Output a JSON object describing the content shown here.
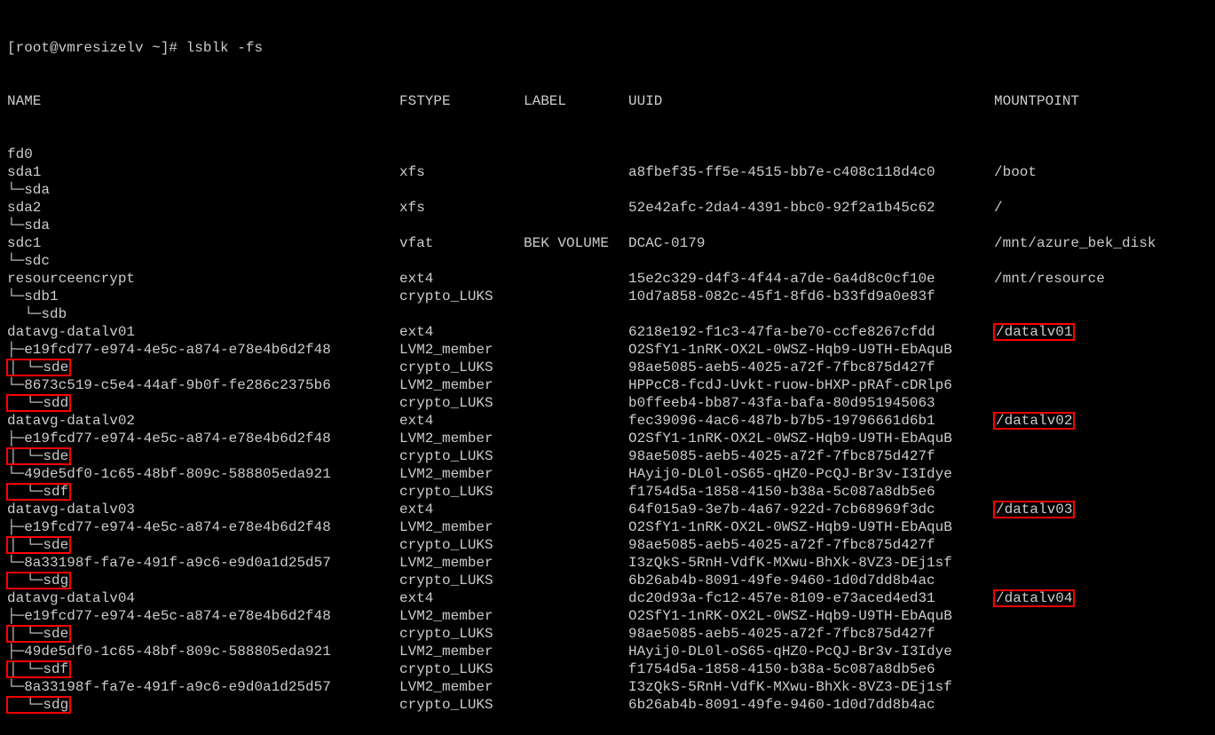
{
  "prompt": "[root@vmresizelv ~]# lsblk -fs",
  "headers": {
    "name": "NAME",
    "fstype": "FSTYPE",
    "label": "LABEL",
    "uuid": "UUID",
    "mountpoint": "MOUNTPOINT"
  },
  "rows": [
    {
      "name": "fd0",
      "fstype": "",
      "label": "",
      "uuid": "",
      "mountpoint": "",
      "hi_name": false,
      "hi_mount": false
    },
    {
      "name": "sda1",
      "fstype": "xfs",
      "label": "",
      "uuid": "a8fbef35-ff5e-4515-bb7e-c408c118d4c0",
      "mountpoint": "/boot",
      "hi_name": false,
      "hi_mount": false
    },
    {
      "name": "└─sda",
      "fstype": "",
      "label": "",
      "uuid": "",
      "mountpoint": "",
      "hi_name": false,
      "hi_mount": false
    },
    {
      "name": "sda2",
      "fstype": "xfs",
      "label": "",
      "uuid": "52e42afc-2da4-4391-bbc0-92f2a1b45c62",
      "mountpoint": "/",
      "hi_name": false,
      "hi_mount": false
    },
    {
      "name": "└─sda",
      "fstype": "",
      "label": "",
      "uuid": "",
      "mountpoint": "",
      "hi_name": false,
      "hi_mount": false
    },
    {
      "name": "sdc1",
      "fstype": "vfat",
      "label": "BEK VOLUME",
      "uuid": "DCAC-0179",
      "mountpoint": "/mnt/azure_bek_disk",
      "hi_name": false,
      "hi_mount": false
    },
    {
      "name": "└─sdc",
      "fstype": "",
      "label": "",
      "uuid": "",
      "mountpoint": "",
      "hi_name": false,
      "hi_mount": false
    },
    {
      "name": "resourceencrypt",
      "fstype": "ext4",
      "label": "",
      "uuid": "15e2c329-d4f3-4f44-a7de-6a4d8c0cf10e",
      "mountpoint": "/mnt/resource",
      "hi_name": false,
      "hi_mount": false
    },
    {
      "name": "└─sdb1",
      "fstype": "crypto_LUKS",
      "label": "",
      "uuid": "10d7a858-082c-45f1-8fd6-b33fd9a0e83f",
      "mountpoint": "",
      "hi_name": false,
      "hi_mount": false
    },
    {
      "name": "  └─sdb",
      "fstype": "",
      "label": "",
      "uuid": "",
      "mountpoint": "",
      "hi_name": false,
      "hi_mount": false
    },
    {
      "name": "datavg-datalv01",
      "fstype": "ext4",
      "label": "",
      "uuid": "6218e192-f1c3-47fa-be70-ccfe8267cfdd",
      "mountpoint": "/datalv01",
      "hi_name": false,
      "hi_mount": true
    },
    {
      "name": "├─e19fcd77-e974-4e5c-a874-e78e4b6d2f48",
      "fstype": "LVM2_member",
      "label": "",
      "uuid": "O2SfY1-1nRK-OX2L-0WSZ-Hqb9-U9TH-EbAquB",
      "mountpoint": "",
      "hi_name": false,
      "hi_mount": false
    },
    {
      "name": "│ └─sde",
      "fstype": "crypto_LUKS",
      "label": "",
      "uuid": "98ae5085-aeb5-4025-a72f-7fbc875d427f",
      "mountpoint": "",
      "hi_name": true,
      "hi_mount": false
    },
    {
      "name": "└─8673c519-c5e4-44af-9b0f-fe286c2375b6",
      "fstype": "LVM2_member",
      "label": "",
      "uuid": "HPPcC8-fcdJ-Uvkt-ruow-bHXP-pRAf-cDRlp6",
      "mountpoint": "",
      "hi_name": false,
      "hi_mount": false
    },
    {
      "name": "  └─sdd",
      "fstype": "crypto_LUKS",
      "label": "",
      "uuid": "b0ffeeb4-bb87-43fa-bafa-80d951945063",
      "mountpoint": "",
      "hi_name": true,
      "hi_mount": false
    },
    {
      "name": "datavg-datalv02",
      "fstype": "ext4",
      "label": "",
      "uuid": "fec39096-4ac6-487b-b7b5-19796661d6b1",
      "mountpoint": "/datalv02",
      "hi_name": false,
      "hi_mount": true
    },
    {
      "name": "├─e19fcd77-e974-4e5c-a874-e78e4b6d2f48",
      "fstype": "LVM2_member",
      "label": "",
      "uuid": "O2SfY1-1nRK-OX2L-0WSZ-Hqb9-U9TH-EbAquB",
      "mountpoint": "",
      "hi_name": false,
      "hi_mount": false
    },
    {
      "name": "│ └─sde",
      "fstype": "crypto_LUKS",
      "label": "",
      "uuid": "98ae5085-aeb5-4025-a72f-7fbc875d427f",
      "mountpoint": "",
      "hi_name": true,
      "hi_mount": false
    },
    {
      "name": "└─49de5df0-1c65-48bf-809c-588805eda921",
      "fstype": "LVM2_member",
      "label": "",
      "uuid": "HAyij0-DL0l-oS65-qHZ0-PcQJ-Br3v-I3Idye",
      "mountpoint": "",
      "hi_name": false,
      "hi_mount": false
    },
    {
      "name": "  └─sdf",
      "fstype": "crypto_LUKS",
      "label": "",
      "uuid": "f1754d5a-1858-4150-b38a-5c087a8db5e6",
      "mountpoint": "",
      "hi_name": true,
      "hi_mount": false
    },
    {
      "name": "datavg-datalv03",
      "fstype": "ext4",
      "label": "",
      "uuid": "64f015a9-3e7b-4a67-922d-7cb68969f3dc",
      "mountpoint": "/datalv03",
      "hi_name": false,
      "hi_mount": true
    },
    {
      "name": "├─e19fcd77-e974-4e5c-a874-e78e4b6d2f48",
      "fstype": "LVM2_member",
      "label": "",
      "uuid": "O2SfY1-1nRK-OX2L-0WSZ-Hqb9-U9TH-EbAquB",
      "mountpoint": "",
      "hi_name": false,
      "hi_mount": false
    },
    {
      "name": "│ └─sde",
      "fstype": "crypto_LUKS",
      "label": "",
      "uuid": "98ae5085-aeb5-4025-a72f-7fbc875d427f",
      "mountpoint": "",
      "hi_name": true,
      "hi_mount": false
    },
    {
      "name": "└─8a33198f-fa7e-491f-a9c6-e9d0a1d25d57",
      "fstype": "LVM2_member",
      "label": "",
      "uuid": "I3zQkS-5RnH-VdfK-MXwu-BhXk-8VZ3-DEj1sf",
      "mountpoint": "",
      "hi_name": false,
      "hi_mount": false
    },
    {
      "name": "  └─sdg",
      "fstype": "crypto_LUKS",
      "label": "",
      "uuid": "6b26ab4b-8091-49fe-9460-1d0d7dd8b4ac",
      "mountpoint": "",
      "hi_name": true,
      "hi_mount": false
    },
    {
      "name": "datavg-datalv04",
      "fstype": "ext4",
      "label": "",
      "uuid": "dc20d93a-fc12-457e-8109-e73aced4ed31",
      "mountpoint": "/datalv04",
      "hi_name": false,
      "hi_mount": true
    },
    {
      "name": "├─e19fcd77-e974-4e5c-a874-e78e4b6d2f48",
      "fstype": "LVM2_member",
      "label": "",
      "uuid": "O2SfY1-1nRK-OX2L-0WSZ-Hqb9-U9TH-EbAquB",
      "mountpoint": "",
      "hi_name": false,
      "hi_mount": false
    },
    {
      "name": "│ └─sde",
      "fstype": "crypto_LUKS",
      "label": "",
      "uuid": "98ae5085-aeb5-4025-a72f-7fbc875d427f",
      "mountpoint": "",
      "hi_name": true,
      "hi_mount": false
    },
    {
      "name": "├─49de5df0-1c65-48bf-809c-588805eda921",
      "fstype": "LVM2_member",
      "label": "",
      "uuid": "HAyij0-DL0l-oS65-qHZ0-PcQJ-Br3v-I3Idye",
      "mountpoint": "",
      "hi_name": false,
      "hi_mount": false
    },
    {
      "name": "│ └─sdf",
      "fstype": "crypto_LUKS",
      "label": "",
      "uuid": "f1754d5a-1858-4150-b38a-5c087a8db5e6",
      "mountpoint": "",
      "hi_name": true,
      "hi_mount": false
    },
    {
      "name": "└─8a33198f-fa7e-491f-a9c6-e9d0a1d25d57",
      "fstype": "LVM2_member",
      "label": "",
      "uuid": "I3zQkS-5RnH-VdfK-MXwu-BhXk-8VZ3-DEj1sf",
      "mountpoint": "",
      "hi_name": false,
      "hi_mount": false
    },
    {
      "name": "  └─sdg",
      "fstype": "crypto_LUKS",
      "label": "",
      "uuid": "6b26ab4b-8091-49fe-9460-1d0d7dd8b4ac",
      "mountpoint": "",
      "hi_name": true,
      "hi_mount": false
    }
  ]
}
